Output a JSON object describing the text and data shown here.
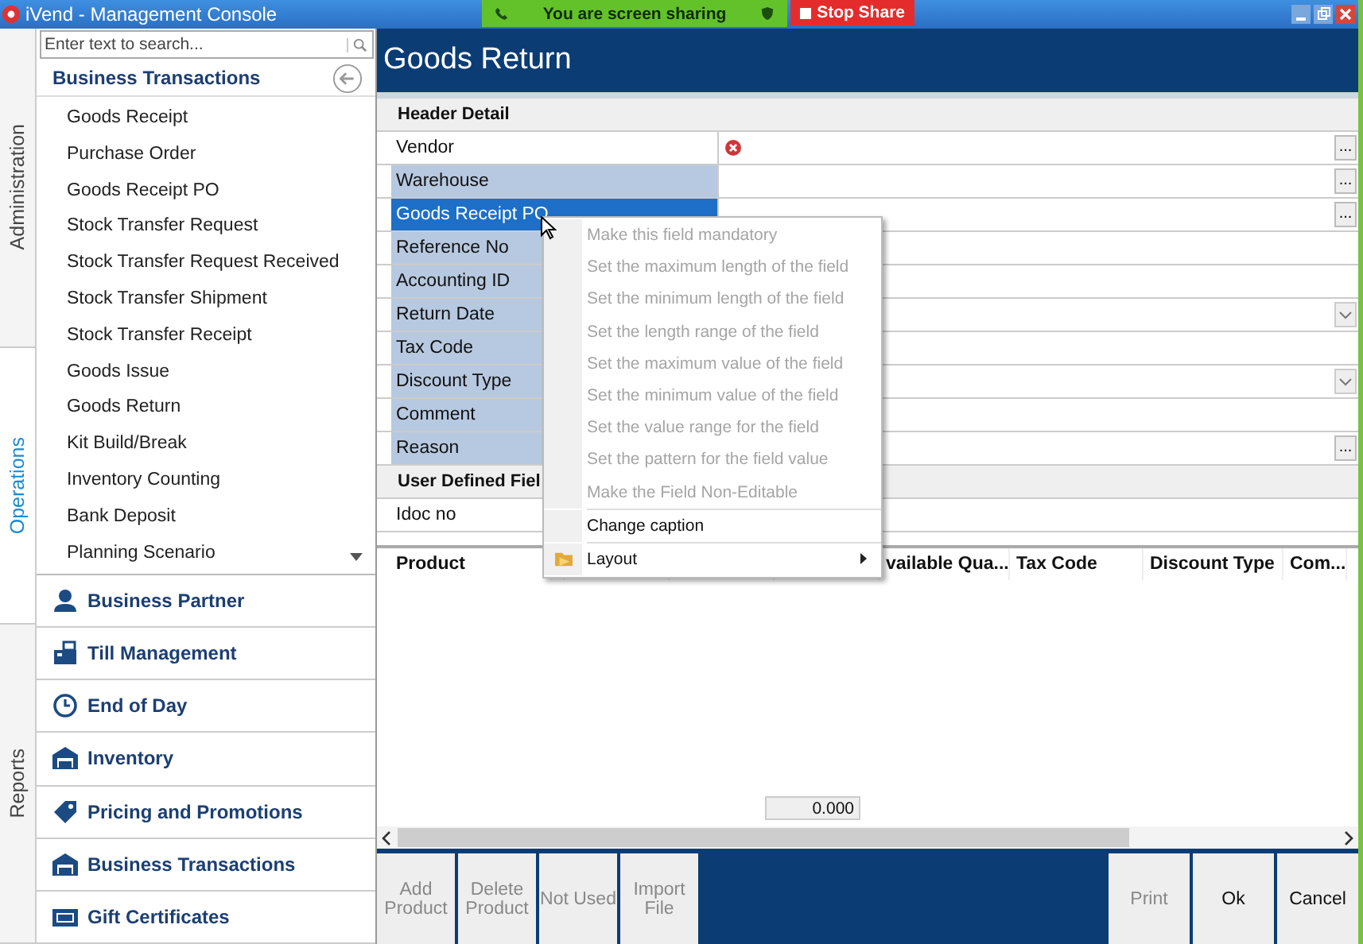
{
  "window": {
    "title": "iVend - Management Console"
  },
  "sharing_banner": {
    "message": "You are screen sharing",
    "stop_button": "Stop Share"
  },
  "side_tabs": [
    {
      "label": "Administration",
      "selected": false
    },
    {
      "label": "Operations",
      "selected": true
    },
    {
      "label": "Reports",
      "selected": false
    }
  ],
  "sidebar": {
    "search": {
      "placeholder": "Enter text to search..."
    },
    "title": "Business Transactions",
    "items": [
      "Goods Receipt",
      "Purchase Order",
      "Goods Receipt PO",
      "Stock Transfer Request",
      "Stock Transfer Request Received",
      "Stock Transfer Shipment",
      "Stock Transfer Receipt",
      "Goods Issue",
      "Goods Return",
      "Kit Build/Break",
      "Inventory Counting",
      "Bank Deposit",
      "Planning Scenario"
    ],
    "groups": [
      {
        "label": "Business Partner",
        "kind": "partner"
      },
      {
        "label": "Till Management",
        "kind": "till"
      },
      {
        "label": "End of Day",
        "kind": "clock"
      },
      {
        "label": "Inventory",
        "kind": "warehouse"
      },
      {
        "label": "Pricing and Promotions",
        "kind": "tag"
      },
      {
        "label": "Business Transactions",
        "kind": "warehouse"
      },
      {
        "label": "Gift Certificates",
        "kind": "card"
      }
    ]
  },
  "page": {
    "title": "Goods Return"
  },
  "form": {
    "sections": [
      {
        "title": "Header Detail",
        "fields": [
          {
            "label": "Vendor",
            "kind": "lookup",
            "button": "...",
            "highlighted": false,
            "selected": false,
            "error": true
          },
          {
            "label": "Warehouse",
            "kind": "lookup",
            "button": "...",
            "highlighted": true,
            "selected": false
          },
          {
            "label": "Goods Receipt PO",
            "kind": "lookup",
            "button": "...",
            "highlighted": true,
            "selected": true
          },
          {
            "label": "Reference No",
            "kind": "text",
            "highlighted": true,
            "selected": false
          },
          {
            "label": "Accounting ID",
            "kind": "text",
            "highlighted": true,
            "selected": false
          },
          {
            "label": "Return Date",
            "kind": "dropdown",
            "highlighted": true,
            "selected": false
          },
          {
            "label": "Tax Code",
            "kind": "text",
            "highlighted": true,
            "selected": false
          },
          {
            "label": "Discount Type",
            "kind": "dropdown",
            "highlighted": true,
            "selected": false
          },
          {
            "label": "Comment",
            "kind": "text",
            "highlighted": true,
            "selected": false
          },
          {
            "label": "Reason",
            "kind": "lookup",
            "button": "...",
            "highlighted": true,
            "selected": false
          }
        ]
      },
      {
        "title": "User Defined Fiel",
        "fields": [
          {
            "label": "Idoc no",
            "kind": "text",
            "highlighted": false,
            "selected": false
          }
        ]
      }
    ]
  },
  "grid": {
    "columns": [
      "Product",
      "",
      "",
      "",
      "vailable Qua...",
      "Tax Code",
      "Discount Type",
      "Com..."
    ],
    "total": "0.000"
  },
  "buttons": [
    {
      "label": "Add Product",
      "disabled": true
    },
    {
      "label": "Delete Product",
      "disabled": true
    },
    {
      "label": "Not Used",
      "disabled": true
    },
    {
      "label": "Import File",
      "disabled": true
    }
  ],
  "right_buttons": [
    {
      "label": "Print",
      "disabled": true
    },
    {
      "label": "Ok",
      "disabled": false
    },
    {
      "label": "Cancel",
      "disabled": false
    }
  ],
  "context_menu": [
    {
      "label": "Make this field mandatory",
      "disabled": true,
      "kind": "item"
    },
    {
      "label": "Set the maximum length of the field",
      "disabled": true,
      "kind": "item"
    },
    {
      "label": "Set the minimum length of the field",
      "disabled": true,
      "kind": "item"
    },
    {
      "label": "Set the length range of the field",
      "disabled": true,
      "kind": "item"
    },
    {
      "label": "Set the maximum value of the field",
      "disabled": true,
      "kind": "item"
    },
    {
      "label": "Set the minimum value of the field",
      "disabled": true,
      "kind": "item"
    },
    {
      "label": "Set the value range for the field",
      "disabled": true,
      "kind": "item"
    },
    {
      "label": "Set the pattern for the field value",
      "disabled": true,
      "kind": "item"
    },
    {
      "label": "Make the Field Non-Editable",
      "disabled": true,
      "kind": "item"
    },
    {
      "label": "Change caption",
      "disabled": false,
      "kind": "item"
    },
    {
      "label": "Layout",
      "disabled": false,
      "kind": "submenu"
    }
  ]
}
